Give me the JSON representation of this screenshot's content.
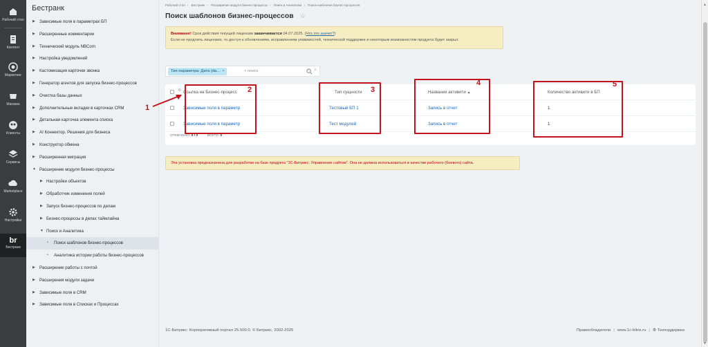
{
  "rail": {
    "items": [
      {
        "label": "Рабочий стол",
        "icon": "desktop-icon"
      },
      {
        "label": "Контент",
        "icon": "content-icon"
      },
      {
        "label": "Маркетинг",
        "icon": "target-icon"
      },
      {
        "label": "Магазин",
        "icon": "cart-icon"
      },
      {
        "label": "Клиенты",
        "icon": "clients-icon"
      },
      {
        "label": "Сервисы",
        "icon": "layers-icon"
      },
      {
        "label": "Marketplace",
        "icon": "cloud-icon"
      },
      {
        "label": "Настройки",
        "icon": "gear-icon"
      },
      {
        "label": "Бестранк",
        "icon": "bestrank-logo-icon"
      }
    ],
    "logo_text": "br"
  },
  "sidebar": {
    "title": "Бестранк",
    "items": [
      {
        "label": "Зависимые поля в параметрах БП",
        "level": 0,
        "expanded": false
      },
      {
        "label": "Расширенные комментарии",
        "level": 0,
        "expanded": false
      },
      {
        "label": "Технический модуль NBCom",
        "level": 0,
        "expanded": false
      },
      {
        "label": "Настройка уведомлений",
        "level": 0,
        "expanded": false
      },
      {
        "label": "Кастомизация карточки звонка",
        "level": 0,
        "expanded": false
      },
      {
        "label": "Генератор агентов для запуска бизнес-процессов",
        "level": 0,
        "expanded": false
      },
      {
        "label": "Очистка базы данных",
        "level": 0,
        "expanded": false
      },
      {
        "label": "Дополнительные вкладки в карточках CRM",
        "level": 0,
        "expanded": false
      },
      {
        "label": "Детальная карточка элемента списка",
        "level": 0,
        "expanded": false
      },
      {
        "label": "AI Коннектор. Решения для бизнеса",
        "level": 0,
        "expanded": false
      },
      {
        "label": "Конструктор обмена",
        "level": 0,
        "expanded": false
      },
      {
        "label": "Расширенная миграция",
        "level": 0,
        "expanded": false
      },
      {
        "label": "Расширение модуля бизнес-процессы",
        "level": 0,
        "expanded": true
      },
      {
        "label": "Настройки объектов",
        "level": 1,
        "expanded": false
      },
      {
        "label": "Обработчик изменения полей",
        "level": 1,
        "expanded": false
      },
      {
        "label": "Запуск бизнес-процессов по делам",
        "level": 1,
        "expanded": false
      },
      {
        "label": "Бизнес-процессы в делах таймлайна",
        "level": 1,
        "expanded": false
      },
      {
        "label": "Поиск и Аналитика",
        "level": 1,
        "expanded": true
      },
      {
        "label": "Поиск шаблонов бизнес-процессов",
        "level": 2,
        "expanded": false,
        "selected": true
      },
      {
        "label": "Аналитика истории работы бизнес-процессов",
        "level": 2,
        "expanded": false
      },
      {
        "label": "Расширение работы с почтой",
        "level": 0,
        "expanded": false
      },
      {
        "label": "Расширения модуля задачи",
        "level": 0,
        "expanded": false
      },
      {
        "label": "Зависимые поля в CRM",
        "level": 0,
        "expanded": false
      },
      {
        "label": "Зависимые поля в Списках и Процессах",
        "level": 0,
        "expanded": false
      }
    ]
  },
  "breadcrumbs": [
    "Рабочий стол",
    "Бестранк",
    "Расширение модуля бизнес-процессы",
    "Поиск и Аналитика",
    "Поиск шаблонов бизнес-процессов"
  ],
  "page_title": "Поиск шаблонов бизнес-процессов",
  "alert": {
    "warn": "Внимание!",
    "text1": " Срок действия текущей лицензии ",
    "text_bold": "заканчивается",
    "text2": " 04.07.2025. (",
    "link": "Что это значит?",
    "text3": ")",
    "line2": "Если не продлить лицензию, то доступ к обновлениям, исправлениям уязвимостей, технической поддержке и некоторым возможностям продукта будет закрыт."
  },
  "filter": {
    "chip": "Тип параметра: Дата (da...",
    "chip_close": "×",
    "placeholder": "+ поиск",
    "clear": "×"
  },
  "table": {
    "columns": [
      "Ссылка на Бизнес-процесс",
      "Тип сущности",
      "Названия активити",
      "Количество активити в БП"
    ],
    "sort_indicator": "▲",
    "rows": [
      [
        "Зависимые поля в параметр",
        "Тестовый БП 1",
        "Запись в отчет",
        "1"
      ],
      [
        "Зависимые поля в параметр",
        "Тест модулей",
        "Запись в отчет",
        "1"
      ]
    ],
    "footer_selected_label": "ОТМЕЧЕНО:",
    "footer_selected_value": "0 / 2",
    "footer_total_label": "ВСЕГО:",
    "footer_total_value": "0"
  },
  "annotations": [
    "1",
    "2",
    "3",
    "4",
    "5"
  ],
  "notice": "Эта установка предназначена для разработки на базе продукта \"1С-Битрикс: Управление сайтом\". Она не должна использоваться в качестве рабочего (боевого) сайта.",
  "footer": {
    "left": "1С-Битрикс: Корпоративный портал 25.500.0. © Битрикс, 2002-2025",
    "rights": "Правообладатели",
    "site": "www.1c-bitrix.ru",
    "support": "Техподдержка"
  },
  "colors": {
    "rail_bg": "#3a3d40",
    "accent_link": "#2067b0",
    "annotation_red": "#c3121b",
    "alert_bg": "#f6edc3",
    "chip_bg": "#bce6f6"
  }
}
